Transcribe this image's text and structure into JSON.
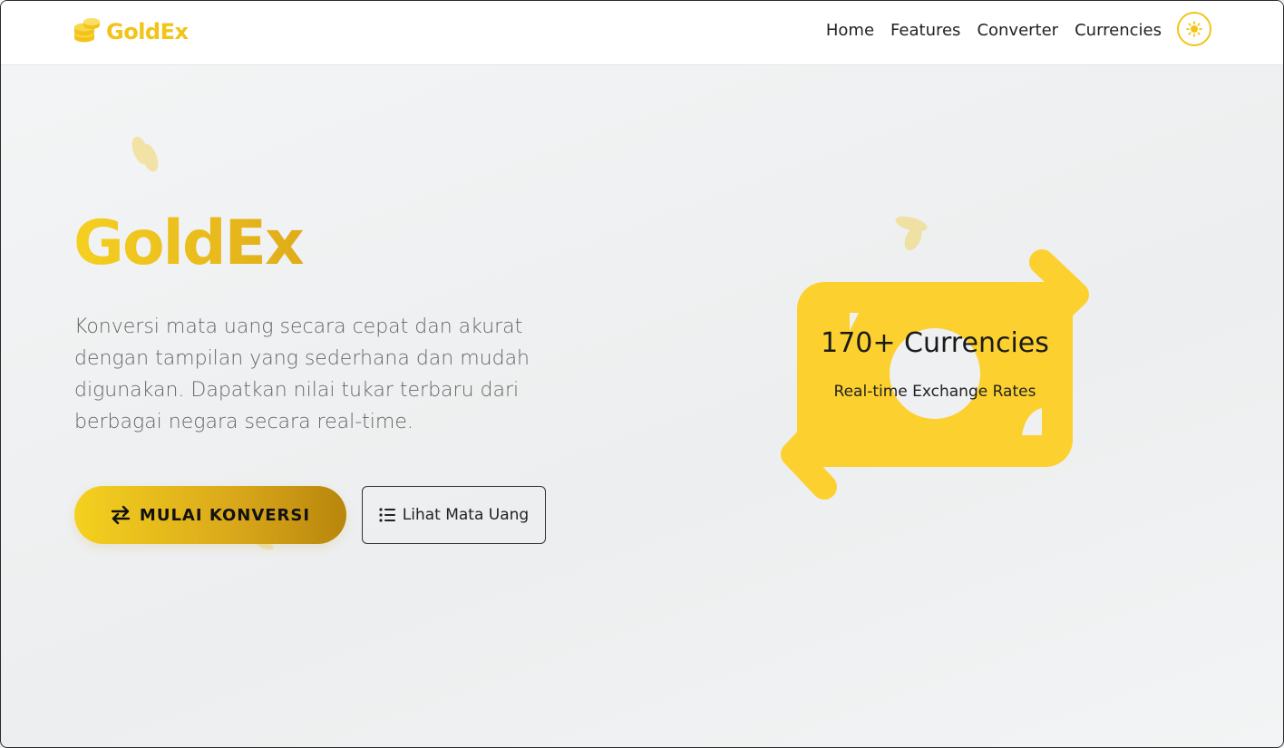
{
  "brand": {
    "name": "GoldEx",
    "icon": "coins-icon",
    "color": "#f2c418"
  },
  "nav": {
    "links": [
      "Home",
      "Features",
      "Converter",
      "Currencies"
    ],
    "theme_toggle_icon": "sun-icon"
  },
  "hero": {
    "title": "GoldEx",
    "description": "Konversi mata uang secara cepat dan akurat dengan tampilan yang sederhana dan mudah digunakan. Dapatkan nilai tukar terbaru dari berbagai negara secara real-time.",
    "primary_button": {
      "label": "MULAI KONVERSI",
      "icon": "exchange-icon"
    },
    "secondary_button": {
      "label": "Lihat Mata Uang",
      "icon": "list-icon"
    }
  },
  "stat": {
    "title": "170+ Currencies",
    "subtitle": "Real-time Exchange Rates",
    "graphic_icon": "money-exchange-icon"
  },
  "colors": {
    "accent": "#f2c418",
    "accent_dark": "#b8860b",
    "background": "#eff0f1"
  }
}
